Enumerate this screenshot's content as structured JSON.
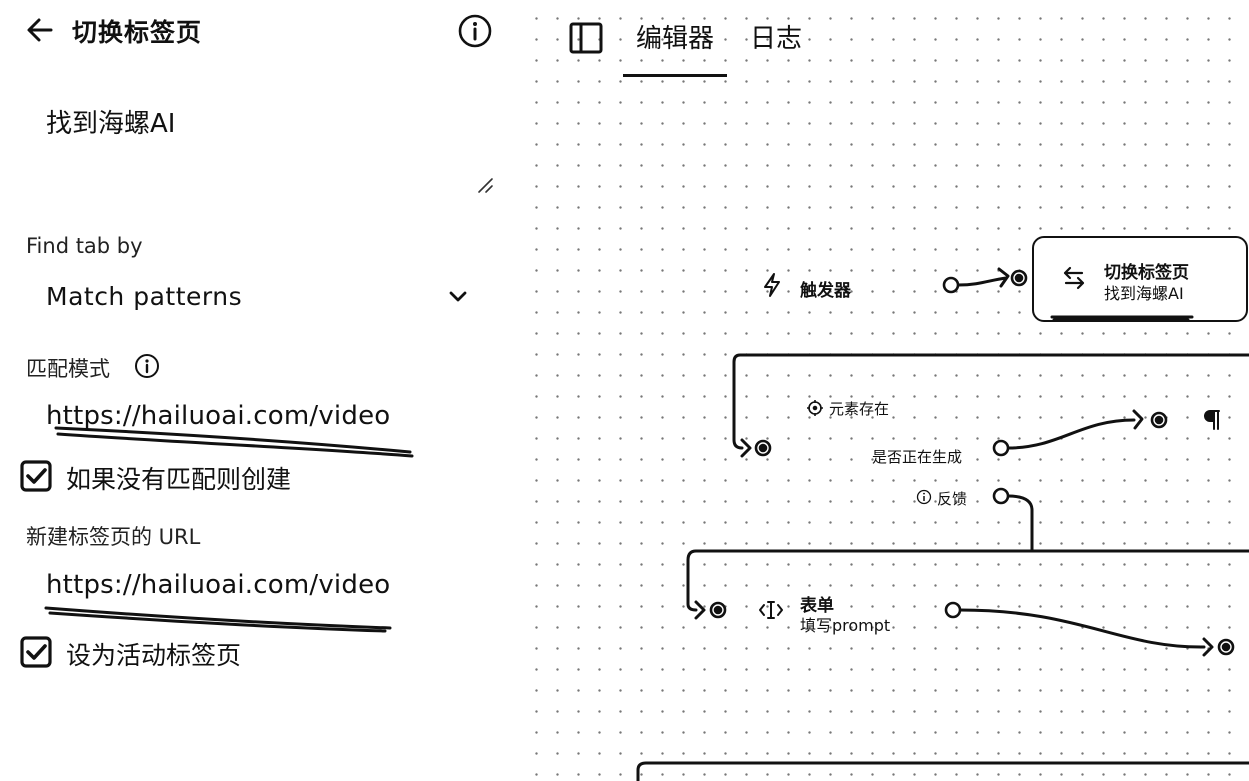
{
  "panel": {
    "title": "切换标签页",
    "description_value": "找到海螺AI",
    "find_tab_label": "Find tab by",
    "find_tab_value": "Match patterns",
    "match_pattern_label": "匹配模式",
    "match_pattern_value": "https://hailuoai.com/video",
    "create_if_none_label": "如果没有匹配则创建",
    "create_if_none_checked": true,
    "new_tab_url_label": "新建标签页的 URL",
    "new_tab_url_value": "https://hailuoai.com/video",
    "set_active_label": "设为活动标签页",
    "set_active_checked": true,
    "icons": [
      "arrow-left-icon",
      "info-circle-icon",
      "resize-grip-icon",
      "chevron-down-icon",
      "checkbox-checked-icon"
    ]
  },
  "topbar": {
    "tabs": [
      {
        "label": "编辑器",
        "active": true
      },
      {
        "label": "日志",
        "active": false
      }
    ],
    "icons": [
      "sidebar-toggle-icon"
    ]
  },
  "nodes": {
    "trigger": {
      "title": "触发器",
      "icon": "lightning-icon"
    },
    "switch_tab": {
      "title": "切换标签页",
      "subtitle": "找到海螺AI",
      "icon": "arrows-swap-icon"
    },
    "element_exists": {
      "title": "元素存在",
      "icon": "crosshair-icon",
      "out_true": "是否正在生成",
      "out_false": "反馈",
      "out_false_icon": "info-circle-icon"
    },
    "form": {
      "title": "表单",
      "subtitle": "填写prompt",
      "icon": "text-cursor-icon"
    },
    "partial_node": {
      "icon": "pilcrow-icon"
    }
  },
  "colors": {
    "ink": "#111111",
    "canvas_dot": "#777777",
    "background": "#ffffff"
  }
}
